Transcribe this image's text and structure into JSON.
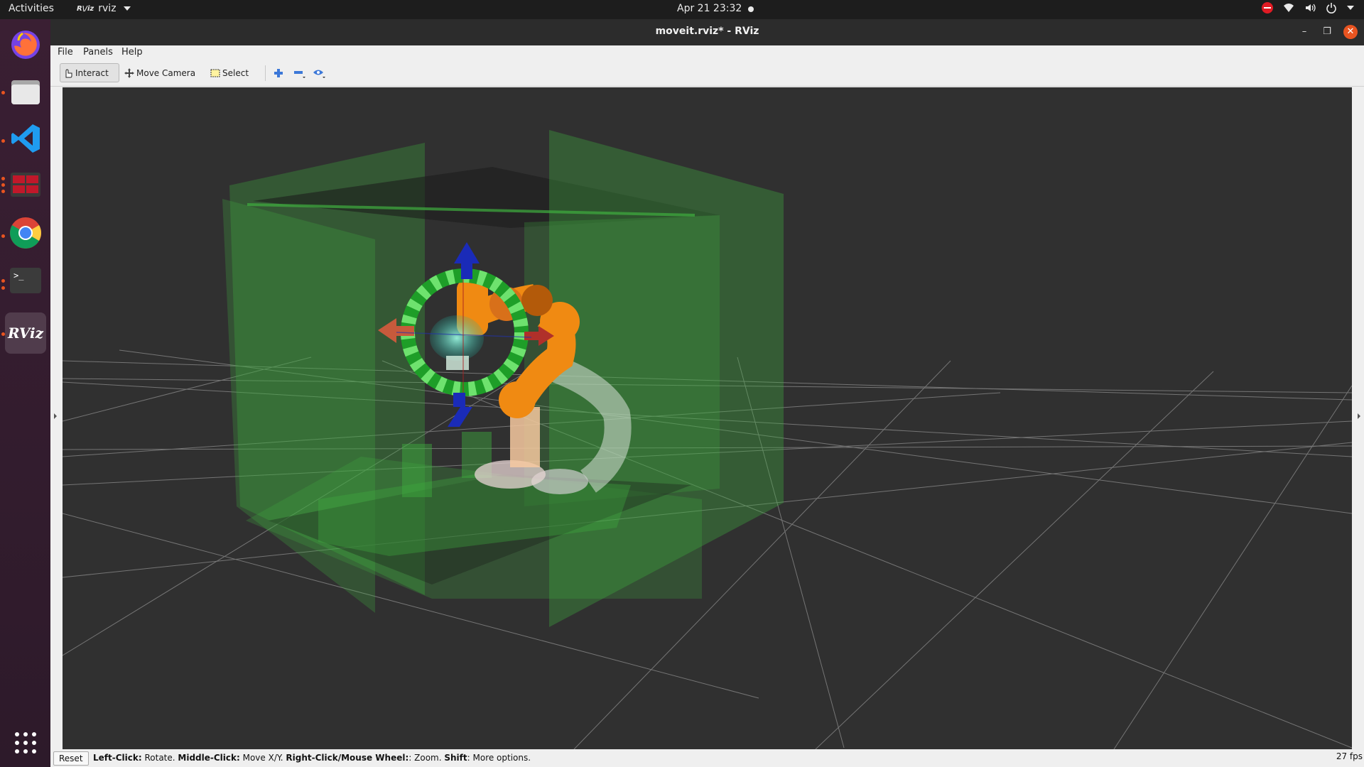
{
  "topbar": {
    "activities": "Activities",
    "app_name": "rviz",
    "app_icon_text": "R\\/iz",
    "clock": "Apr 21  23:32"
  },
  "dock": {
    "items": [
      "firefox-icon",
      "files-icon",
      "vscode-icon",
      "app-grid-red-icon",
      "chrome-icon",
      "terminal-icon",
      "rviz-icon"
    ],
    "rviz_label": "RViz"
  },
  "window": {
    "title": "moveit.rviz* - RViz"
  },
  "menu": {
    "file": "File",
    "panels": "Panels",
    "help": "Help"
  },
  "toolbar": {
    "interact": "Interact",
    "move_camera": "Move Camera",
    "select": "Select"
  },
  "status": {
    "reset": "Reset",
    "left_click_key": "Left-Click:",
    "left_click_desc": " Rotate. ",
    "middle_click_key": "Middle-Click:",
    "middle_click_desc": " Move X/Y. ",
    "right_click_key": "Right-Click/Mouse Wheel:",
    "right_click_desc": ": Zoom. ",
    "shift_key": "Shift",
    "shift_desc": ": More options.",
    "fps": "27 fps"
  },
  "colors": {
    "accent": "#e95420",
    "viewport_bg": "#303030",
    "grid": "#9a9a9a",
    "scene_green": "#3fae3f",
    "robot_orange": "#f08a12"
  }
}
